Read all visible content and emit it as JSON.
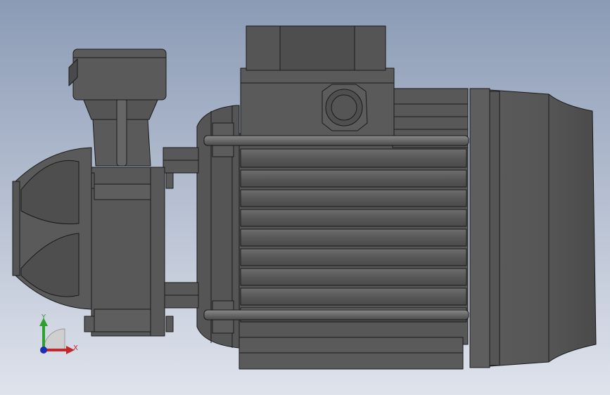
{
  "viewport": {
    "background_top": "#8b9bb5",
    "background_bottom": "#dfe3ec",
    "model_color": "#5a5a5a",
    "model_dark": "#3f3f3f",
    "model_light": "#7a7a7a",
    "edge_color": "#1a1a1a"
  },
  "triad": {
    "x_label": "X",
    "y_label": "Y",
    "x_color": "#c0282a",
    "y_color": "#2fa02f",
    "z_color": "#1b2fb5"
  }
}
